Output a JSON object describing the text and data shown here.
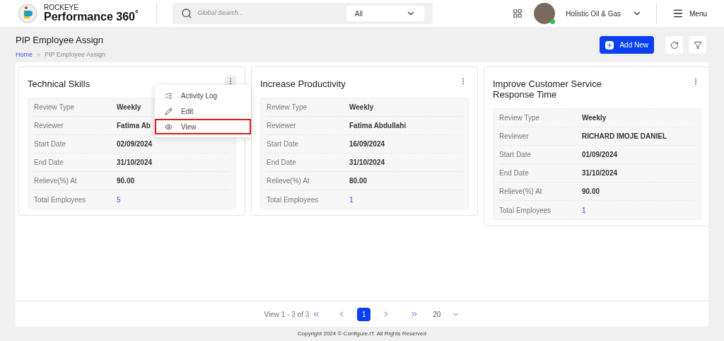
{
  "header": {
    "brand_small": "ROCKEYE",
    "brand": "Performance 360",
    "brand_mark": "°",
    "search": {
      "placeholder": "Global Search...",
      "scope": "All"
    },
    "company": "Holistic Oil & Gas",
    "menu": "Menu"
  },
  "page": {
    "title": "PIP Employee Assign",
    "breadcrumb": [
      "Home",
      "PIP Employee Assign"
    ],
    "add_button": "Add New"
  },
  "cards": [
    {
      "title": "Technical Skills",
      "fields": [
        {
          "label": "Review Type",
          "value": "Weekly"
        },
        {
          "label": "Reviewer",
          "value": "Fatima Ab"
        },
        {
          "label": "Start Date",
          "value": "02/09/2024"
        },
        {
          "label": "End Date",
          "value": "31/10/2024"
        },
        {
          "label": "Relieve(%) At",
          "value": "90.00"
        },
        {
          "label": "Total Employees",
          "value": "5",
          "kind": "link"
        }
      ],
      "menu_open": true
    },
    {
      "title": "Increase Productivity",
      "fields": [
        {
          "label": "Review Type",
          "value": "Weekly"
        },
        {
          "label": "Reviewer",
          "value": "Fatima Abdullahi"
        },
        {
          "label": "Start Date",
          "value": "16/09/2024"
        },
        {
          "label": "End Date",
          "value": "31/10/2024"
        },
        {
          "label": "Relieve(%) At",
          "value": "80.00"
        },
        {
          "label": "Total Employees",
          "value": "1",
          "kind": "link"
        }
      ],
      "menu_open": false
    },
    {
      "title": "Improve Customer Service Response Time",
      "fields": [
        {
          "label": "Review Type",
          "value": "Weekly"
        },
        {
          "label": "Reviewer",
          "value": "RICHARD IMOJE DANIEL"
        },
        {
          "label": "Start Date",
          "value": "01/09/2024"
        },
        {
          "label": "End Date",
          "value": "31/10/2024"
        },
        {
          "label": "Relieve(%) At",
          "value": "90.00"
        },
        {
          "label": "Total Employees",
          "value": "1",
          "kind": "link"
        }
      ],
      "menu_open": false
    }
  ],
  "context_menu": [
    {
      "label": "Activity Log",
      "kind": "log",
      "selected": false
    },
    {
      "label": "Edit",
      "kind": "edit",
      "selected": false
    },
    {
      "label": "View",
      "kind": "view",
      "selected": true
    }
  ],
  "pagination": {
    "summary": "View 1 - 3 of 3",
    "pages": [
      {
        "label": "1",
        "selected": true
      }
    ],
    "page_size": "20"
  },
  "footer": "Copyright 2024 © Configure.IT. All Rights Reserved"
}
